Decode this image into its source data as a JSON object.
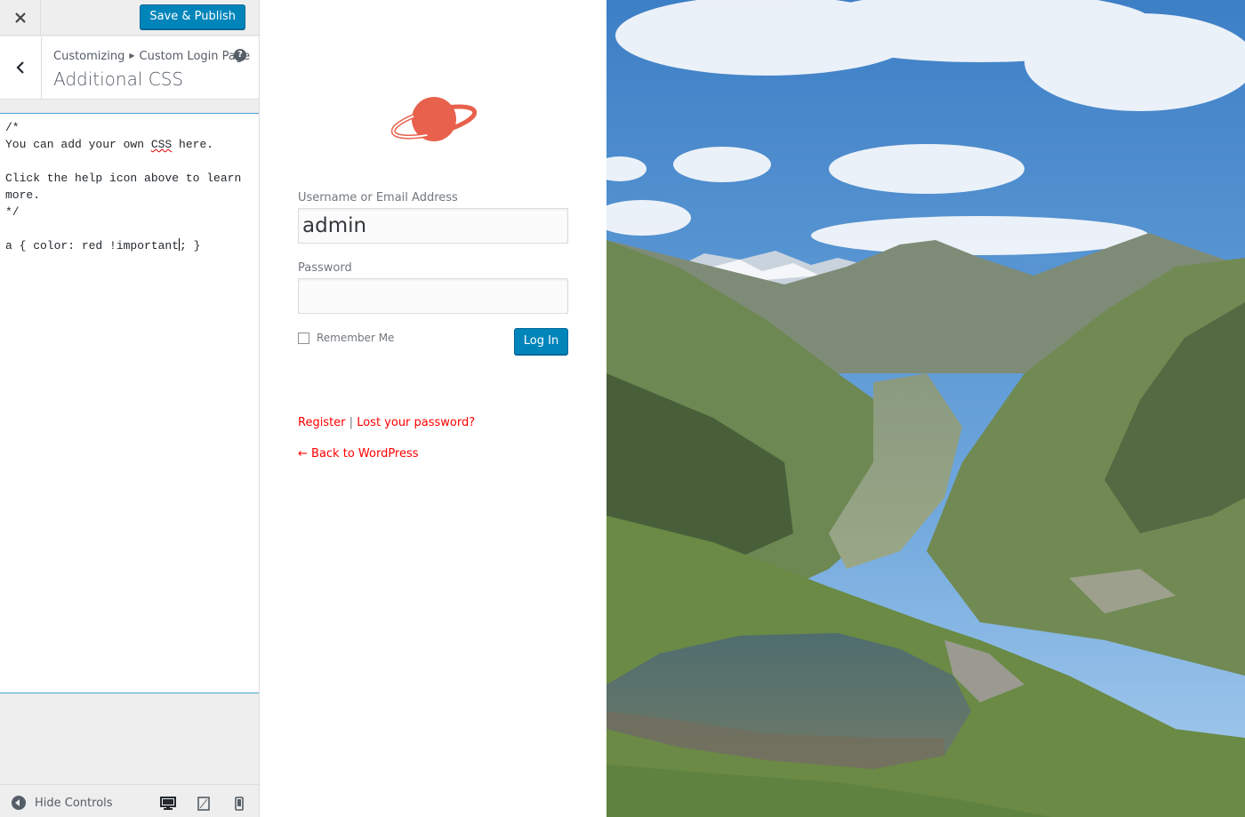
{
  "customizer": {
    "close_icon": "close-icon",
    "save_label": "Save & Publish",
    "breadcrumb": {
      "parent": "Customizing",
      "child": "Custom Login Page"
    },
    "section_title": "Additional CSS",
    "css_code": {
      "line1": "/*",
      "line2_pre": "You can add your own ",
      "line2_word": "CSS",
      "line2_post": " here.",
      "line4": "Click the help icon above to learn",
      "line5": "more.",
      "line6": "*/",
      "line8_pre": "a { color: red !important",
      "line8_post": "; }"
    },
    "footer": {
      "hide_label": "Hide Controls"
    }
  },
  "login": {
    "username_label": "Username or Email Address",
    "username_value": "admin",
    "password_label": "Password",
    "remember_label": "Remember Me",
    "login_label": "Log In",
    "register_link": "Register",
    "separator": "|",
    "lost_password_link": "Lost your password?",
    "back_link": "← Back to WordPress"
  },
  "colors": {
    "accent_blue": "#0085ba",
    "logo_coral": "#e8614d",
    "link_red": "#ff0000"
  }
}
